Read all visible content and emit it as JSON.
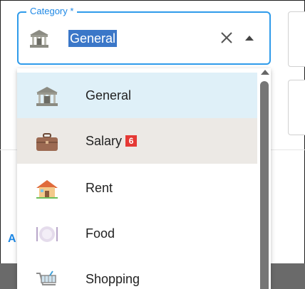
{
  "field": {
    "label": "Category *",
    "value": "General",
    "clear_icon": "close-icon",
    "toggle_icon": "caret-up-icon"
  },
  "options": [
    {
      "label": "General",
      "icon": "bank-building-icon",
      "highlighted": true
    },
    {
      "label": "Salary",
      "icon": "briefcase-icon",
      "badge": "6",
      "hovered": true
    },
    {
      "label": "Rent",
      "icon": "house-icon"
    },
    {
      "label": "Food",
      "icon": "plate-cutlery-icon"
    },
    {
      "label": "Shopping",
      "icon": "shopping-cart-icon"
    }
  ],
  "background": {
    "partial_link_text": "A"
  },
  "colors": {
    "accent": "#1e88e5",
    "highlight": "#dff0f8",
    "hover": "#ece9e5",
    "badge": "#e53935"
  }
}
